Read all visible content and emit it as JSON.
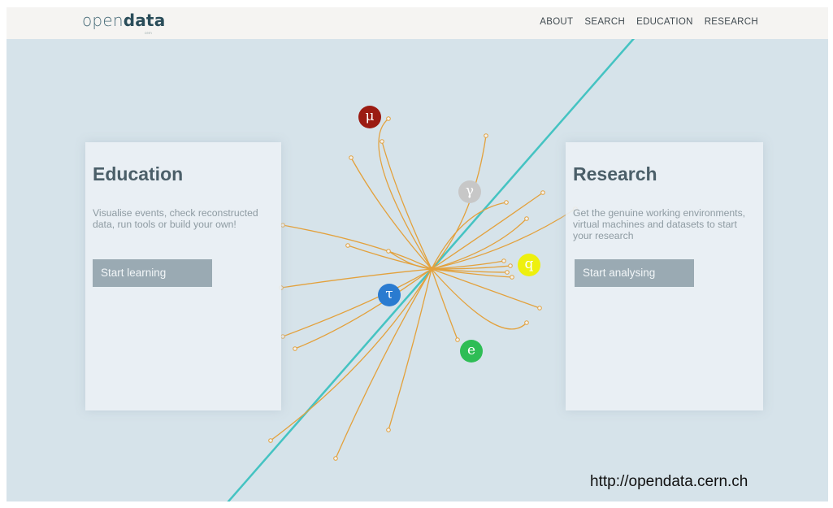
{
  "logo": {
    "light": "open",
    "bold": "data",
    "sub": "cern"
  },
  "nav": {
    "items": [
      "ABOUT",
      "SEARCH",
      "EDUCATION",
      "RESEARCH"
    ]
  },
  "education": {
    "title": "Education",
    "body": "Visualise events, check reconstructed data, run tools or build your own!",
    "button": "Start learning"
  },
  "research": {
    "title": "Research",
    "body": "Get the genuine working environments, virtual machines and datasets to start your research",
    "button": "Start analysing"
  },
  "particles": [
    {
      "symbol": "μ",
      "name": "muon",
      "color": "#9b1b12"
    },
    {
      "symbol": "γ",
      "name": "photon",
      "color": "#c7c7c7"
    },
    {
      "symbol": "q",
      "name": "quark",
      "color": "#eef00e"
    },
    {
      "symbol": "τ",
      "name": "tau",
      "color": "#2a7bd0"
    },
    {
      "symbol": "e",
      "name": "electron",
      "color": "#2ebd55"
    }
  ],
  "colors": {
    "track": "#e3a13c",
    "beam": "#45c3c2",
    "background": "#d6e3ea"
  },
  "url": "http://opendata.cern.ch"
}
